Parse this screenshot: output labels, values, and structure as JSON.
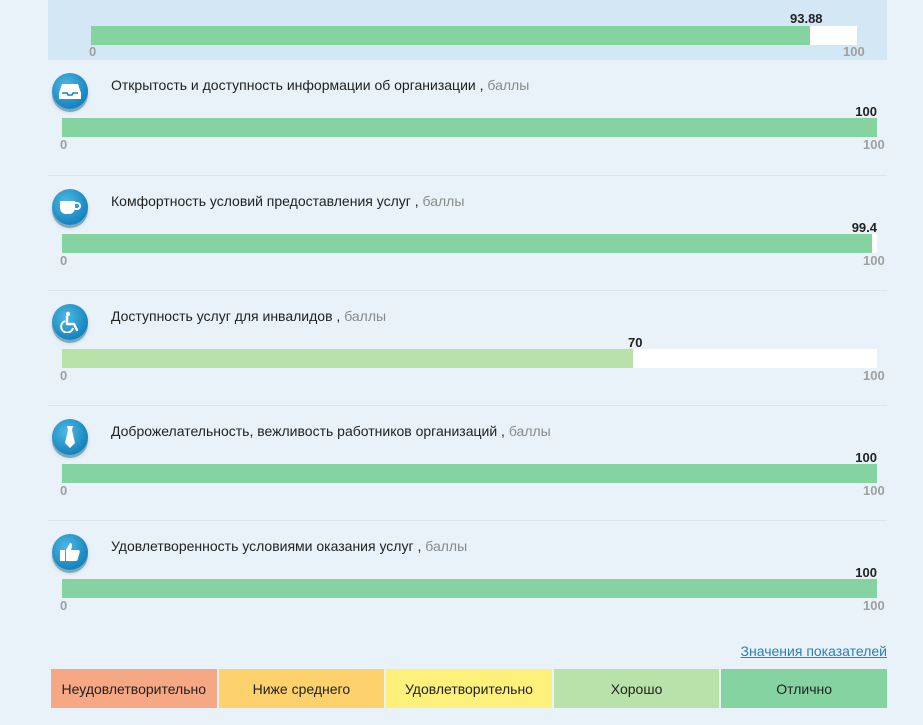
{
  "colors": {
    "bar_green": "#86d3a2",
    "bar_light_green": "#b8e2a9",
    "icon_blue": "#1b8cc6"
  },
  "summary": {
    "value": "93.88",
    "min": "0",
    "max": "100",
    "progress": 0.9388
  },
  "sections": [
    {
      "title": "Открытость и доступность информации об организации ,",
      "unit": "баллы",
      "icon": "inbox-tray-icon",
      "value": "100",
      "min": "0",
      "max": "100",
      "progress": 1.0
    },
    {
      "title": "Комфортность условий предоставления услуг ,",
      "unit": "баллы",
      "icon": "coffee-cup-icon",
      "value": "99.4",
      "min": "0",
      "max": "100",
      "progress": 0.994
    },
    {
      "title": "Доступность услуг для инвалидов ,",
      "unit": "баллы",
      "icon": "wheelchair-icon",
      "value": "70",
      "min": "0",
      "max": "100",
      "progress": 0.7
    },
    {
      "title": "Доброжелательность, вежливость работников организаций ,",
      "unit": "баллы",
      "icon": "necktie-icon",
      "value": "100",
      "min": "0",
      "max": "100",
      "progress": 1.0
    },
    {
      "title": "Удовлетворенность условиями оказания услуг ,",
      "unit": "баллы",
      "icon": "thumbs-up-icon",
      "value": "100",
      "min": "0",
      "max": "100",
      "progress": 1.0
    }
  ],
  "legend": {
    "link_label": "Значения показателей",
    "items": [
      {
        "label": "Неудовлетворительно",
        "color": "#f6a784"
      },
      {
        "label": "Ниже среднего",
        "color": "#fdd26c"
      },
      {
        "label": "Удовлетворительно",
        "color": "#fdf17b"
      },
      {
        "label": "Хорошо",
        "color": "#b8e2a9"
      },
      {
        "label": "Отлично",
        "color": "#86d3a2"
      }
    ]
  }
}
